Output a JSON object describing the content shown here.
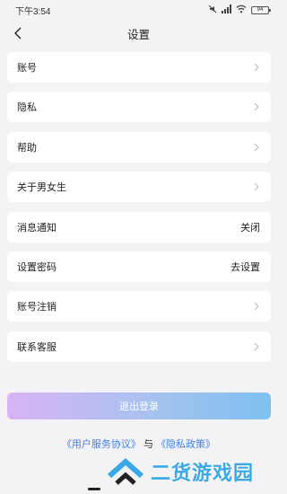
{
  "status_bar": {
    "time": "下午3:54",
    "battery": "94"
  },
  "header": {
    "title": "设置"
  },
  "settings": [
    {
      "label": "账号",
      "value": ""
    },
    {
      "label": "隐私",
      "value": ""
    },
    {
      "label": "帮助",
      "value": ""
    },
    {
      "label": "关于男女生",
      "value": ""
    },
    {
      "label": "消息通知",
      "value": "关闭"
    },
    {
      "label": "设置密码",
      "value": "去设置"
    },
    {
      "label": "账号注销",
      "value": ""
    },
    {
      "label": "联系客服",
      "value": ""
    }
  ],
  "logout": {
    "label": "退出登录"
  },
  "agreement": {
    "user_agreement": "《用户服务协议》",
    "conjunction": "与",
    "privacy_policy": "《隐私政策》"
  },
  "watermark": {
    "text": "二货游戏园"
  },
  "colors": {
    "accent_link": "#3d7ff0",
    "watermark": "#3aa8e6"
  }
}
